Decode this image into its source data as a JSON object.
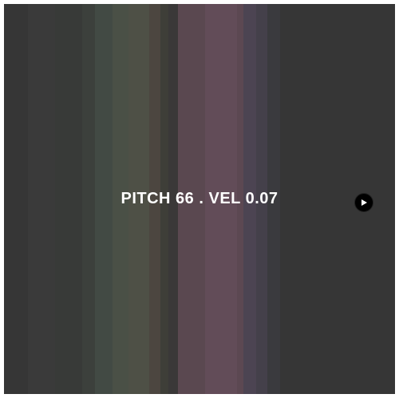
{
  "readout": {
    "pitch_velocity_text": "PITCH 66 . VEL 0.07"
  },
  "controls": {
    "play_icon": "play-icon"
  },
  "colors": {
    "background": "#363636",
    "stripes": [
      "#363636",
      "#3a3a3a",
      "#383a38",
      "#3c403c",
      "#424a44",
      "#4a5046",
      "#4e5046",
      "#4c4640",
      "#3e3e38",
      "#3a3838",
      "#5a4850",
      "#624c58",
      "#5c4852",
      "#4c4452",
      "#44404a",
      "#3a3a3e",
      "#363636"
    ]
  }
}
